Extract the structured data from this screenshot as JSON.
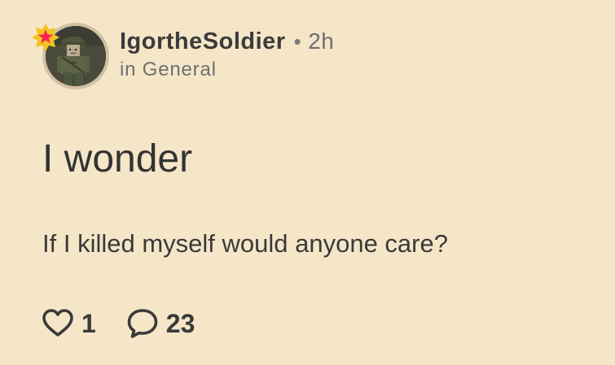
{
  "post": {
    "author": {
      "username": "IgortheSoldier",
      "separator": "•",
      "time": "2h",
      "community_prefix": "in",
      "community": "General",
      "badge_color": "#ff1f5a",
      "badge_bg": "#f3c321"
    },
    "title": "I wonder",
    "body": "If I killed myself would anyone care?",
    "actions": {
      "like_icon": "heart-outline-icon",
      "like_count": "1",
      "comment_icon": "speech-bubble-outline-icon",
      "comment_count": "23"
    }
  },
  "colors": {
    "background": "#f5e6c8",
    "text_primary": "#333333",
    "text_secondary": "#6f6f6f"
  }
}
